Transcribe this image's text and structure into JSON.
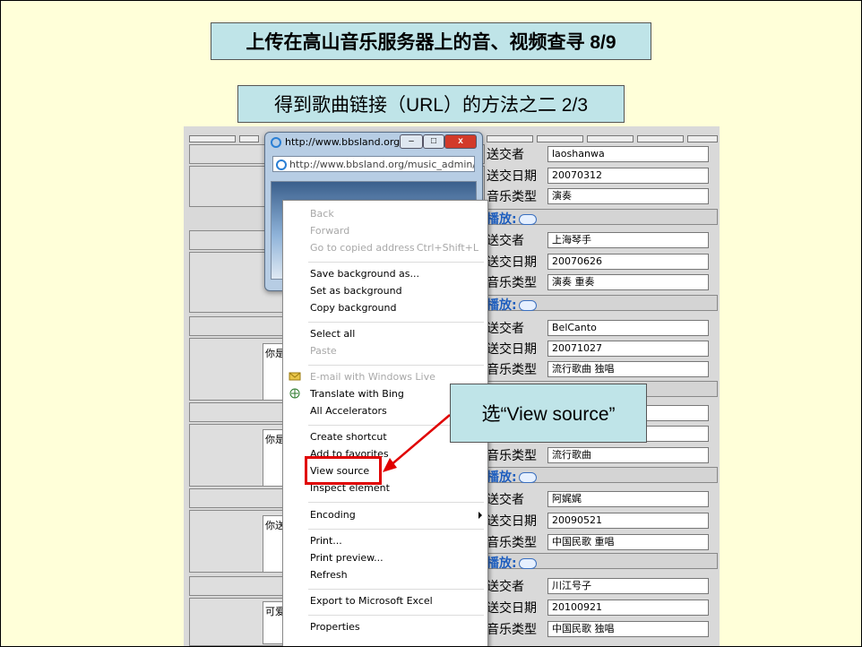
{
  "slide": {
    "title": "上传在高山音乐服务器上的音、视频查寻 8/9",
    "subtitle": "得到歌曲链接（URL）的方法之二 2/3",
    "callout": "选“View source”"
  },
  "browser_popup": {
    "title": "http://www.bbsland.org/...",
    "address": "http://www.bbsland.org/music_admin/clip"
  },
  "context_menu": {
    "items": [
      {
        "label": "Back",
        "disabled": true
      },
      {
        "label": "Forward",
        "disabled": true
      },
      {
        "label": "Go to copied address",
        "shortcut": "Ctrl+Shift+L",
        "disabled": true
      },
      {
        "label": "Save background as..."
      },
      {
        "label": "Set as background"
      },
      {
        "label": "Copy background"
      },
      {
        "label": "Select all"
      },
      {
        "label": "Paste",
        "disabled": true
      },
      {
        "label": "E-mail with Windows Live",
        "disabled": true
      },
      {
        "label": "Translate with Bing"
      },
      {
        "label": "All Accelerators"
      },
      {
        "label": "Create shortcut"
      },
      {
        "label": "Add to favorites"
      },
      {
        "label": "View source",
        "highlighted": true
      },
      {
        "label": "Inspect element"
      },
      {
        "label": "Encoding",
        "submenu": true
      },
      {
        "label": "Print..."
      },
      {
        "label": "Print preview..."
      },
      {
        "label": "Refresh"
      },
      {
        "label": "Export to Microsoft Excel"
      },
      {
        "label": "Properties"
      }
    ]
  },
  "records": [
    {
      "submitter_label": "送交者",
      "submitter": "laoshanwa",
      "date_label": "送交日期",
      "date": "20070312",
      "type_label": "音乐类型",
      "type": "演奏"
    },
    {
      "play_label": "播放:",
      "submitter_label": "送交者",
      "submitter": "上海琴手",
      "date_label": "送交日期",
      "date": "20070626",
      "type_label": "音乐类型",
      "type": "演奏 重奏"
    },
    {
      "play_label": "播放:",
      "submitter_label": "送交者",
      "submitter": "BelCanto",
      "date_label": "送交日期",
      "date": "20071027",
      "type_label": "音乐类型",
      "type": "流行歌曲 独唱"
    },
    {
      "type_label": "音乐类型",
      "type": "流行歌曲"
    },
    {
      "play_label": "播放:",
      "submitter_label": "送交者",
      "submitter": "阿娓娓",
      "date_label": "送交日期",
      "date": "20090521",
      "type_label": "音乐类型",
      "type": "中国民歌 重唱"
    },
    {
      "play_label": "播放:",
      "submitter_label": "送交者",
      "submitter": "川江号子",
      "date_label": "送交日期",
      "date": "20100921",
      "type_label": "音乐类型",
      "type": "中国民歌 独唱"
    }
  ],
  "left_snippets": [
    "你是",
    "你是",
    "你送",
    "可爱"
  ]
}
